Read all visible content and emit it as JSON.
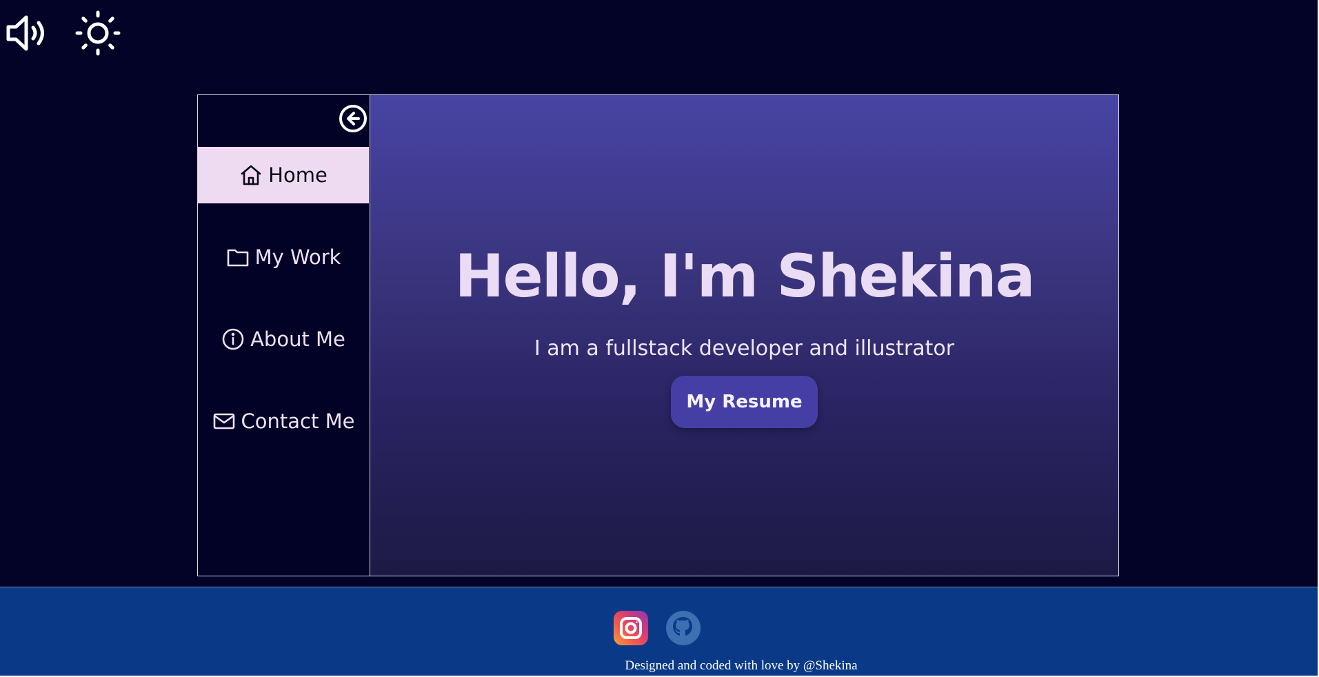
{
  "controls": {
    "sound_icon": "speaker-icon",
    "theme_icon": "sun-icon"
  },
  "sidebar": {
    "back_icon": "arrow-left-circle-icon",
    "items": [
      {
        "label": "Home",
        "icon": "home-icon",
        "active": true
      },
      {
        "label": "My Work",
        "icon": "folder-icon",
        "active": false
      },
      {
        "label": "About Me",
        "icon": "info-icon",
        "active": false
      },
      {
        "label": "Contact Me",
        "icon": "mail-icon",
        "active": false
      }
    ]
  },
  "hero": {
    "title": "Hello, I'm Shekina",
    "subtitle": "I am a fullstack developer and illustrator",
    "button_label": "My Resume"
  },
  "footer": {
    "social": [
      {
        "name": "instagram",
        "icon": "instagram-icon"
      },
      {
        "name": "github",
        "icon": "github-icon"
      }
    ],
    "credit": "Designed and coded with love by @Shekina"
  },
  "colors": {
    "background": "#020327",
    "active_nav": "#efdbf1",
    "accent": "#453fa5",
    "footer": "#0a3a87"
  }
}
